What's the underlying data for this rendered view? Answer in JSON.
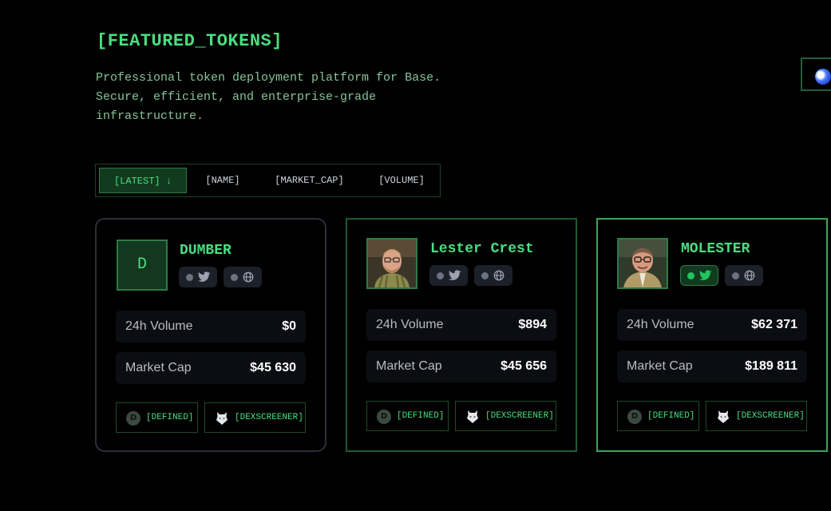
{
  "header": {
    "title": "[FEATURED_TOKENS]",
    "subtitle": "Professional token deployment platform for Base. Secure, efficient, and enterprise-grade infrastructure."
  },
  "sort": {
    "options": [
      {
        "label": "[LATEST] ↓",
        "active": true
      },
      {
        "label": "[NAME]",
        "active": false
      },
      {
        "label": "[MARKET_CAP]",
        "active": false
      },
      {
        "label": "[VOLUME]",
        "active": false
      }
    ]
  },
  "tokens": [
    {
      "name": "DUMBER",
      "avatar_letter": "D",
      "twitter_active": false,
      "stats": {
        "volume_label": "24h Volume",
        "volume": "$0",
        "mcap_label": "Market Cap",
        "mcap": "$45 630"
      },
      "links": {
        "defined": "[DEFINED]",
        "dexscreener": "[DEXSCREENER]"
      }
    },
    {
      "name": "Lester Crest",
      "avatar_icon": "portrait-photo",
      "twitter_active": false,
      "stats": {
        "volume_label": "24h Volume",
        "volume": "$894",
        "mcap_label": "Market Cap",
        "mcap": "$45 656"
      },
      "links": {
        "defined": "[DEFINED]",
        "dexscreener": "[DEXSCREENER]"
      }
    },
    {
      "name": "MOLESTER",
      "avatar_icon": "portrait-photo",
      "twitter_active": true,
      "stats": {
        "volume_label": "24h Volume",
        "volume": "$62 371",
        "mcap_label": "Market Cap",
        "mcap": "$189 811"
      },
      "links": {
        "defined": "[DEFINED]",
        "dexscreener": "[DEXSCREENER]"
      }
    }
  ],
  "colors": {
    "accent": "#4ade80",
    "background": "#000000",
    "card_border_featured": "#3fa35a"
  }
}
